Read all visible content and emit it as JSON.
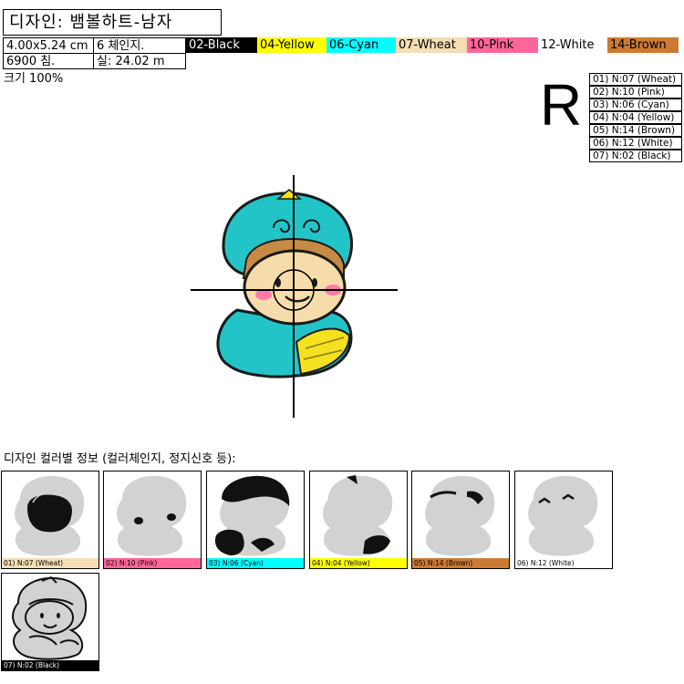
{
  "design": {
    "title": "디자인: 뱀볼하트-남자",
    "size": "4.00x5.24 cm",
    "color_changes": "6 체인지.",
    "stitches": "6900 침.",
    "thread_length": "실: 24.02 m",
    "scale": "크기 100%",
    "orientation_mark": "R"
  },
  "palette": [
    {
      "label": "02-Black",
      "bg": "#000000",
      "fg": "#ffffff"
    },
    {
      "label": "04-Yellow",
      "bg": "#ffff00",
      "fg": "#000000"
    },
    {
      "label": "06-Cyan",
      "bg": "#00ffff",
      "fg": "#000000"
    },
    {
      "label": "07-Wheat",
      "bg": "#f5deb3",
      "fg": "#000000"
    },
    {
      "label": "10-Pink",
      "bg": "#ff6699",
      "fg": "#000000"
    },
    {
      "label": "12-White",
      "bg": "#ffffff",
      "fg": "#000000"
    },
    {
      "label": "14-Brown",
      "bg": "#cc7a33",
      "fg": "#000000"
    }
  ],
  "sequence": [
    "01) N:07 (Wheat)",
    "02) N:10 (Pink)",
    "03) N:06 (Cyan)",
    "04) N:04 (Yellow)",
    "05) N:14 (Brown)",
    "06) N:12 (White)",
    "07) N:02 (Black)"
  ],
  "section_title": "디자인 컬러별 정보 (컬러체인지, 정지신호 등):",
  "thumbnails": [
    {
      "caption": "01) N:07 (Wheat)",
      "bar": "#f5deb3",
      "fg": "#000000"
    },
    {
      "caption": "02) N:10 (Pink)",
      "bar": "#ff6699",
      "fg": "#000000"
    },
    {
      "caption": "03) N:06 (Cyan)",
      "bar": "#00ffff",
      "fg": "#000000"
    },
    {
      "caption": "04) N:04 (Yellow)",
      "bar": "#ffff00",
      "fg": "#000000"
    },
    {
      "caption": "05) N:14 (Brown)",
      "bar": "#cc7a33",
      "fg": "#000000"
    },
    {
      "caption": "06) N:12 (White)",
      "bar": "#ffffff",
      "fg": "#000000"
    },
    {
      "caption": "07) N:02 (Black)",
      "bar": "#000000",
      "fg": "#ffffff"
    }
  ]
}
